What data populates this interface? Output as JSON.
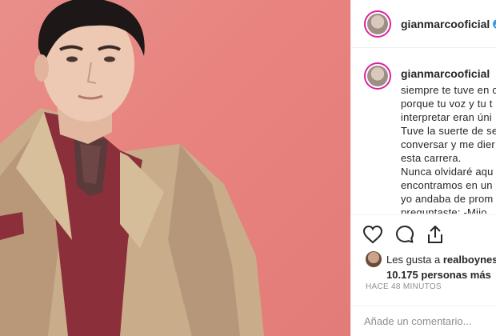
{
  "post": {
    "username": "gianmarcooficial",
    "caption_username": "gianmarcooficial",
    "caption_lines": [
      "siempre te tuve en c",
      "porque tu voz y tu t",
      "interpretar eran úni",
      "Tuve la suerte de se",
      "conversar y me dier",
      "esta carrera.",
      "Nunca olvidaré aqu",
      "encontramos en un",
      "yo andaba de prom",
      "preguntaste: -Mijo"
    ],
    "likes_prefix": "Les gusta a",
    "likes_user": "realboynes",
    "likes_count": "10.175 personas más",
    "time_ago": "HACE 48 MINUTOS",
    "comment_placeholder": "Añade un comentario..."
  },
  "icons": {
    "verified": "verified-badge-icon",
    "like": "heart-icon",
    "comment": "comment-bubble-icon",
    "share": "share-icon"
  },
  "colors": {
    "background_photo": "#e8837f",
    "verified": "#3897f0",
    "story_ring": "#d6249f",
    "muted_text": "#8e8e8e"
  }
}
